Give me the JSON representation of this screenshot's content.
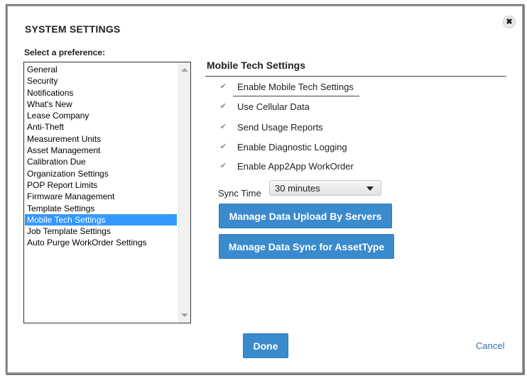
{
  "dialog": {
    "title": "SYSTEM SETTINGS",
    "close_icon": "close-icon",
    "pref_label": "Select a preference:"
  },
  "preferences": {
    "items": [
      "General",
      "Security",
      "Notifications",
      "What's New",
      "Lease Company",
      "Anti-Theft",
      "Measurement Units",
      "Asset Management",
      "Calibration Due",
      "Organization Settings",
      "POP Report Limits",
      "Firmware Management",
      "Template Settings",
      "Mobile Tech Settings",
      "Job Template Settings",
      "Auto Purge WorkOrder Settings"
    ],
    "selected": "Mobile Tech Settings"
  },
  "panel": {
    "title": "Mobile Tech Settings",
    "checkboxes": [
      {
        "label": "Enable Mobile Tech Settings",
        "checked": true
      },
      {
        "label": "Use Cellular Data",
        "checked": true
      },
      {
        "label": "Send Usage Reports",
        "checked": true
      },
      {
        "label": "Enable Diagnostic Logging",
        "checked": true
      },
      {
        "label": "Enable App2App WorkOrder",
        "checked": true
      }
    ],
    "sync_label": "Sync Time",
    "sync_value": "30 minutes",
    "btn_upload": "Manage Data Upload By Servers",
    "btn_sync": "Manage Data Sync for AssetType"
  },
  "footer": {
    "done": "Done",
    "cancel": "Cancel"
  },
  "colors": {
    "accent": "#3a8bcd",
    "selection": "#3399ff",
    "link": "#2d74b3"
  }
}
